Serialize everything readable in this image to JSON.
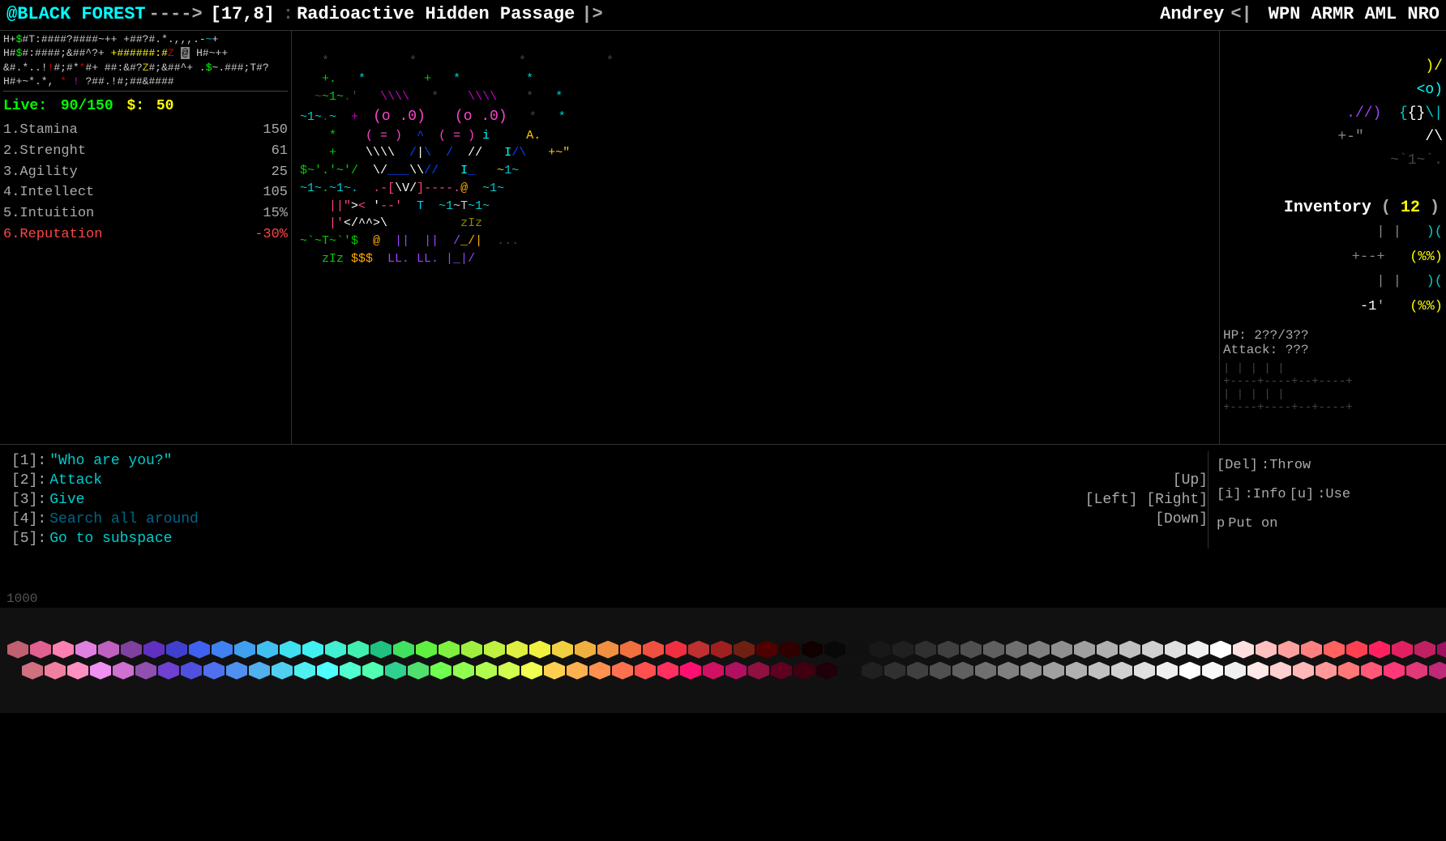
{
  "titleBar": {
    "location": "@BLACK FOREST",
    "arrow": "---->",
    "coords": "[17,8]",
    "areaName": "Radioactive Hidden Passage",
    "separator": "|>",
    "playerName": "Andrey",
    "statLabels": "WPN ARMR AML NRO"
  },
  "leftPanel": {
    "noiseLines": [
      "H+$#T:####?####~++",
      "+##?#.*.,,,.-~+",
      "H#$#:####;&##^?+",
      "+######:#Z  @ H#~++",
      "&#.*..!#;#*#+",
      "##:&#?#Z#;&##^+",
      ".$~.###;T#?",
      "H#+~*.*,  *!",
      "?##.!#;##&####"
    ],
    "liveLabel": "Live:",
    "liveVal": "90/150",
    "moneyLabel": "$:",
    "moneyVal": "50",
    "stats": [
      {
        "num": "1",
        "name": "Stamina",
        "val": "150"
      },
      {
        "num": "2",
        "name": "Strenght",
        "val": "61"
      },
      {
        "num": "3",
        "name": "Agility",
        "val": "25"
      },
      {
        "num": "4",
        "name": "Intellect",
        "val": "105"
      },
      {
        "num": "5",
        "name": "Intuition",
        "val": "15%"
      },
      {
        "num": "6",
        "name": "Reputation",
        "val": "-30%",
        "color": "red"
      }
    ]
  },
  "rightPanel": {
    "inventoryLabel": "Inventory",
    "inventoryCount": "12",
    "items": [
      ")(  +--+",
      "(%%)  |  |",
      ")(  +--+",
      "(%%)  1i"
    ],
    "hpLabel": "HP:",
    "hpVal": "2??/3??",
    "attackLabel": "Attack:",
    "attackVal": "???"
  },
  "actions": [
    {
      "num": "[1]",
      "label": "\"Who are you?\"",
      "dim": false
    },
    {
      "num": "[2]",
      "label": "Attack",
      "dim": false
    },
    {
      "num": "[3]",
      "label": "Give",
      "dim": false
    },
    {
      "num": "[4]",
      "label": "Search all around",
      "dim": true
    },
    {
      "num": "[5]",
      "label": "Go to subspace",
      "dim": false
    }
  ],
  "keyHints": {
    "up": "[Up]",
    "left": "[Left]",
    "right": "[Right]",
    "down": "[Down]",
    "del": "[Del]",
    "delLabel": "Throw",
    "i": "[i]",
    "iLabel": "Info",
    "u": "[u]",
    "uLabel": "Use",
    "p": "p",
    "pLabel": "Put on"
  },
  "footer": {
    "number": "1000"
  },
  "palette": {
    "colors": [
      "#c06080",
      "#e060a0",
      "#ff80c0",
      "#e080e0",
      "#c060c0",
      "#8040a0",
      "#6030c0",
      "#4040e0",
      "#4060ff",
      "#4080ff",
      "#40a0ff",
      "#40c0ff",
      "#40e0ff",
      "#40ffff",
      "#40ffe0",
      "#40ffc0",
      "#20c080",
      "#40e060",
      "#60ff40",
      "#80ff40",
      "#a0ff40",
      "#c0ff40",
      "#e0ff40",
      "#ffff40",
      "#ffe040",
      "#ffc040",
      "#ffa040",
      "#ff8040",
      "#ff6040",
      "#ff4040",
      "#e04040",
      "#c03030",
      "#802020",
      "#601010",
      "#400000",
      "#200000",
      "#100000",
      "#000000",
      "#101010",
      "#202020",
      "#303030",
      "#404040",
      "#505050",
      "#606060",
      "#707070",
      "#808080",
      "#909090",
      "#a0a0a0",
      "#b0b0b0",
      "#c0c0c0",
      "#d0d0d0",
      "#e0e0e0",
      "#f0f0f0",
      "#ffffff",
      "#ffe0e0",
      "#ffc0c0",
      "#ffa0a0",
      "#ff8080",
      "#ff6060",
      "#ff4060",
      "#ff2060",
      "#e02060",
      "#c02060",
      "#a02060"
    ]
  }
}
